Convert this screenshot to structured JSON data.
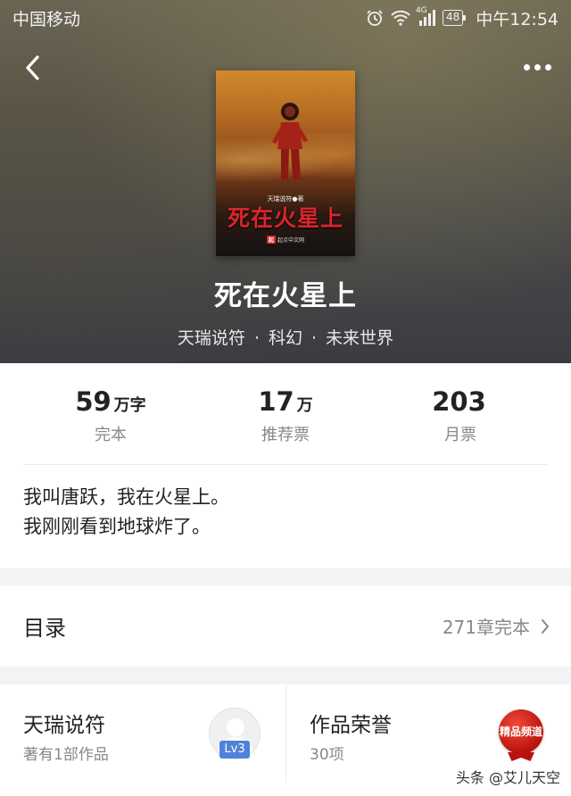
{
  "status_bar": {
    "carrier": "中国移动",
    "network": "4G",
    "battery": "48",
    "time": "中午12:54"
  },
  "book": {
    "cover_author": "天瑞说符●著",
    "cover_title": "死在火星上",
    "cover_publisher": "起点中文网",
    "cover_publisher_mark": "起",
    "title": "死在火星上",
    "author": "天瑞说符",
    "category": "科幻",
    "subcategory": "未来世界",
    "meta_separator": "·"
  },
  "stats": [
    {
      "value": "59",
      "unit": "万字",
      "label": "完本"
    },
    {
      "value": "17",
      "unit": "万",
      "label": "推荐票"
    },
    {
      "value": "203",
      "unit": "",
      "label": "月票"
    }
  ],
  "synopsis": {
    "line1": "我叫唐跃，我在火星上。",
    "line2": "我刚刚看到地球炸了。"
  },
  "catalog": {
    "title": "目录",
    "status": "271章完本"
  },
  "author_card": {
    "name": "天瑞说符",
    "works": "著有1部作品",
    "level": "Lv3"
  },
  "honor_card": {
    "title": "作品荣誉",
    "count": "30项",
    "badge_text": "精品频道"
  },
  "watermark": "头条 @艾儿天空",
  "colors": {
    "accent_blue": "#4f82d8",
    "honor_red": "#d8252a"
  }
}
